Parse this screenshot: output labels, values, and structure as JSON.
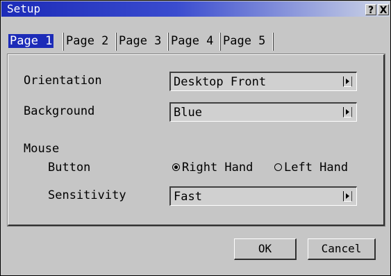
{
  "window": {
    "title": "Setup",
    "help_label": "?",
    "close_label": "X"
  },
  "tabs": [
    {
      "label": "Page 1",
      "active": true
    },
    {
      "label": "Page 2",
      "active": false
    },
    {
      "label": "Page 3",
      "active": false
    },
    {
      "label": "Page 4",
      "active": false
    },
    {
      "label": "Page 5",
      "active": false
    }
  ],
  "settings": {
    "orientation": {
      "label": "Orientation",
      "value": "Desktop Front"
    },
    "background": {
      "label": "Background",
      "value": "Blue"
    },
    "mouse": {
      "label": "Mouse",
      "button": {
        "label": "Button",
        "options": [
          {
            "label": "Right Hand",
            "selected": true
          },
          {
            "label": "Left Hand",
            "selected": false
          }
        ]
      },
      "sensitivity": {
        "label": "Sensitivity",
        "value": "Fast"
      }
    }
  },
  "footer": {
    "ok_label": "OK",
    "cancel_label": "Cancel"
  },
  "colors": {
    "titlebar": "#1c2bb8",
    "window_bg": "#c6c6c6",
    "active_tab": "#1c2bb8"
  },
  "icons": {
    "help": "help-icon",
    "close": "close-icon",
    "dropdown": "right-arrow-icon",
    "radio": "radio-icon"
  }
}
